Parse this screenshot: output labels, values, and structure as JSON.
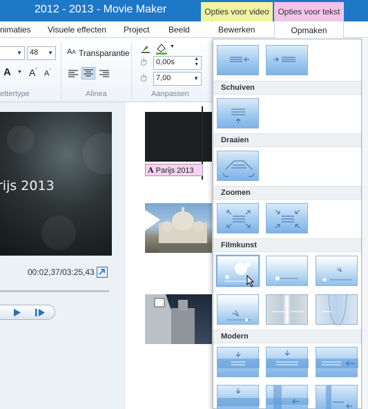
{
  "window": {
    "title": "2012 - 2013 - Movie Maker"
  },
  "context_tabs": {
    "video": "Opties voor video",
    "text": "Opties voor tekst"
  },
  "tabs": [
    {
      "label": "nimaties"
    },
    {
      "label": "Visuele effecten"
    },
    {
      "label": "Project"
    },
    {
      "label": "Beeld"
    },
    {
      "label": "Bewerken"
    },
    {
      "label": "Opmaken"
    }
  ],
  "ribbon": {
    "font": {
      "size": "48",
      "group_label": "ettertype",
      "grow_icon": "font-grow-icon",
      "shrink_icon": "font-shrink-icon"
    },
    "paragraph": {
      "transparency_label": "Transparantie",
      "group_label": "Alinea"
    },
    "adjust": {
      "start_time": "0,00s",
      "duration": "7,00",
      "group_label": "Aanpassen"
    }
  },
  "preview": {
    "video_text": "rijs 2013",
    "timecode": "00:02,37/03:25,43"
  },
  "storyboard": {
    "caption": "Parijs 2013"
  },
  "effects_menu": {
    "sections": [
      {
        "label": "Schuiven"
      },
      {
        "label": "Draaien"
      },
      {
        "label": "Zoomen"
      },
      {
        "label": "Filmkunst"
      },
      {
        "label": "Modern"
      }
    ]
  },
  "colors": {
    "title_bar": "#1e78c8",
    "video_context": "#eef4a0",
    "text_context": "#f3c3ea"
  }
}
